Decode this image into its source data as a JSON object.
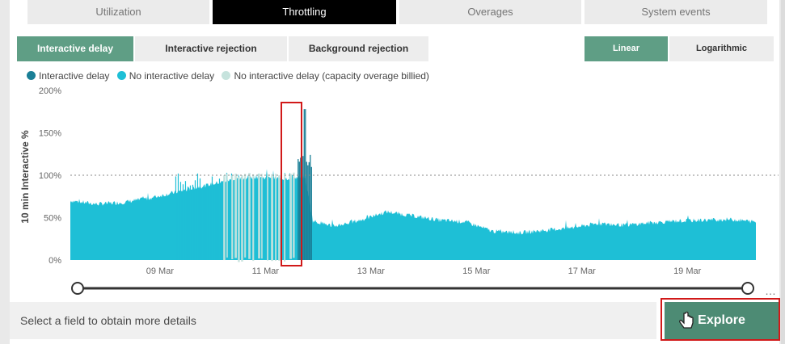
{
  "tabs": [
    "Utilization",
    "Throttling",
    "Overages",
    "System events"
  ],
  "subtabs": [
    "Interactive delay",
    "Interactive rejection",
    "Background rejection"
  ],
  "scale": {
    "linear": "Linear",
    "log": "Logarithmic"
  },
  "legend": [
    {
      "label": "Interactive delay",
      "color": "#1a7f96"
    },
    {
      "label": "No interactive delay",
      "color": "#1ebfd6"
    },
    {
      "label": "No interactive delay (capacity overage billied)",
      "color": "#c6e3dd"
    }
  ],
  "footer": {
    "text": "Select a field to obtain more details",
    "explore": "Explore"
  },
  "chart_data": {
    "type": "area",
    "ylabel": "10 min Interactive %",
    "ylim": [
      0,
      200
    ],
    "yticks": [
      "0%",
      "50%",
      "100%",
      "150%",
      "200%"
    ],
    "xticks": [
      "09 Mar",
      "11 Mar",
      "13 Mar",
      "15 Mar",
      "17 Mar",
      "19 Mar"
    ],
    "reference_line": 100,
    "x": [
      7.3,
      7.8,
      8.3,
      8.8,
      9.3,
      9.8,
      10.3,
      10.8,
      11.3,
      11.6,
      11.75,
      11.9,
      12.3,
      12.8,
      13.3,
      13.8,
      14.3,
      14.8,
      15.3,
      15.8,
      16.3,
      16.8,
      17.3,
      17.8,
      18.3,
      18.8,
      19.3,
      19.8,
      20.3
    ],
    "series": [
      {
        "name": "No interactive delay",
        "values": [
          70,
          66,
          68,
          73,
          80,
          87,
          94,
          98,
          96,
          97,
          98,
          46,
          40,
          47,
          57,
          52,
          47,
          45,
          34,
          32,
          35,
          38,
          43,
          41,
          44,
          46,
          47,
          48,
          45
        ]
      },
      {
        "name": "No interactive delay (capacity overage billied)",
        "values": [
          null,
          null,
          null,
          null,
          100,
          100,
          98,
          99,
          100,
          100,
          null,
          null,
          null,
          null,
          null,
          null,
          null,
          null,
          null,
          null,
          null,
          null,
          null,
          null,
          null,
          null,
          null,
          null,
          null
        ]
      },
      {
        "name": "Interactive delay",
        "values": [
          null,
          null,
          null,
          null,
          null,
          null,
          null,
          null,
          null,
          112,
          178,
          null,
          null,
          null,
          null,
          null,
          null,
          null,
          null,
          null,
          null,
          null,
          null,
          null,
          null,
          null,
          null,
          null,
          null
        ]
      }
    ]
  }
}
